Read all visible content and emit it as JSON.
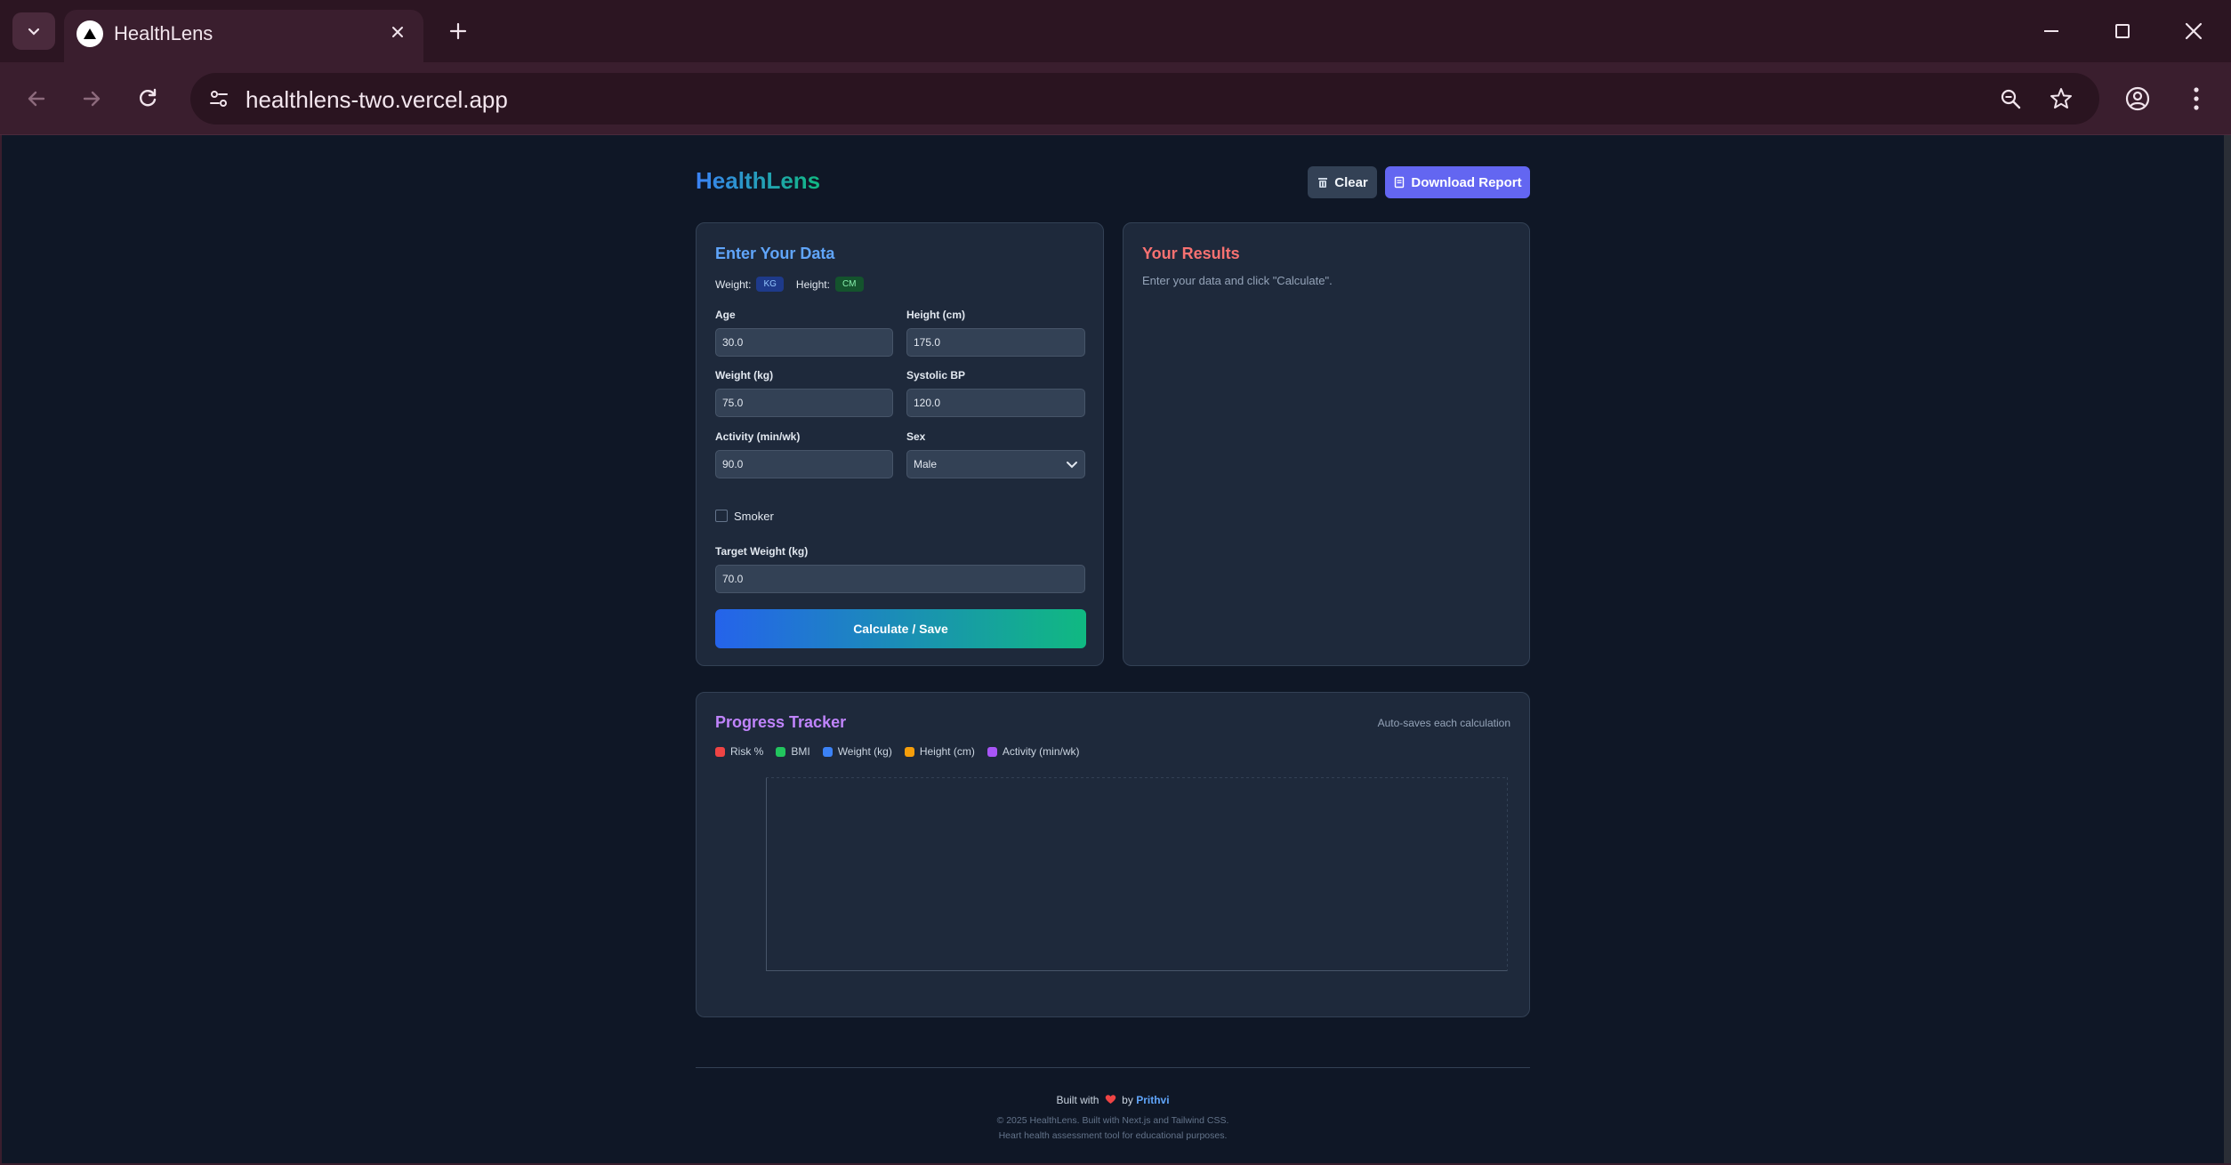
{
  "browser": {
    "tab_title": "HealthLens",
    "url": "healthlens-two.vercel.app"
  },
  "app": {
    "brand": "HealthLens",
    "clear_label": "Clear",
    "report_label": "Download Report"
  },
  "input_card": {
    "title": "Enter Your Data",
    "weight_unit_label": "Weight:",
    "weight_unit": "KG",
    "height_unit_label": "Height:",
    "height_unit": "CM",
    "age_label": "Age",
    "age_value": "30.0",
    "height_label": "Height (cm)",
    "height_value": "175.0",
    "weight_label": "Weight (kg)",
    "weight_value": "75.0",
    "bp_label": "Systolic BP",
    "bp_value": "120.0",
    "activity_label": "Activity (min/wk)",
    "activity_value": "90.0",
    "sex_label": "Sex",
    "sex_value": "Male",
    "smoker_label": "Smoker",
    "smoker_checked": false,
    "target_label": "Target Weight (kg)",
    "target_value": "70.0",
    "calc_label": "Calculate / Save"
  },
  "results_card": {
    "title": "Your Results",
    "hint": "Enter your data and click \"Calculate\"."
  },
  "progress_card": {
    "title": "Progress Tracker",
    "autosave": "Auto-saves each calculation",
    "legend": [
      {
        "label": "Risk %",
        "color": "#ef4444"
      },
      {
        "label": "BMI",
        "color": "#22c55e"
      },
      {
        "label": "Weight (kg)",
        "color": "#3b82f6"
      },
      {
        "label": "Height (cm)",
        "color": "#f59e0b"
      },
      {
        "label": "Activity (min/wk)",
        "color": "#a855f7"
      }
    ]
  },
  "footer": {
    "built_prefix": "Built with",
    "built_by": "by",
    "author": "Prithvi",
    "copyright": "© 2025 HealthLens. Built with Next.js and Tailwind CSS.",
    "disclaimer": "Heart health assessment tool for educational purposes."
  }
}
